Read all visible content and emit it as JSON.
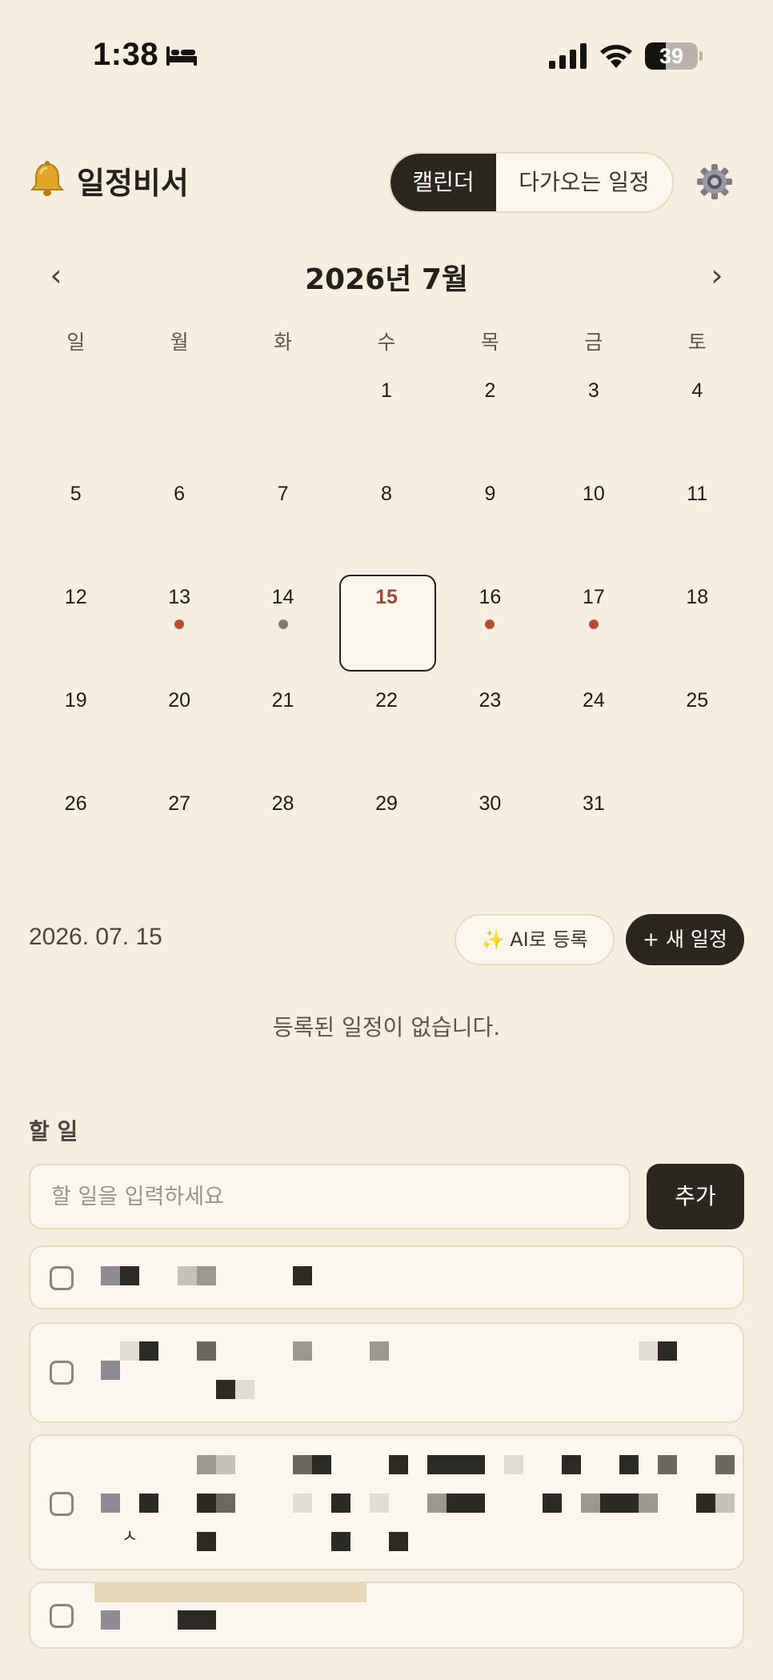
{
  "status_bar": {
    "time": "1:38",
    "battery_percent": 39,
    "battery_label": "39",
    "icons": [
      "bed-icon",
      "cellular-signal-icon",
      "wifi-icon",
      "battery-icon"
    ]
  },
  "header": {
    "logo_icon": "bell-icon",
    "title": "일정비서",
    "view_tabs": [
      {
        "label": "캘린더",
        "active": true
      },
      {
        "label": "다가오는 일정",
        "active": false
      }
    ],
    "settings_icon": "gear-icon"
  },
  "calendar": {
    "month_title": "2026년 7월",
    "prev_label": "‹",
    "next_label": "›",
    "weekdays": [
      "일",
      "월",
      "화",
      "수",
      "목",
      "금",
      "토"
    ],
    "leading_empty_days": 3,
    "days_in_month": 31,
    "selected_day": 15,
    "event_days": [
      {
        "day": 13,
        "color": "#b84c34"
      },
      {
        "day": 14,
        "color": "#827a6c"
      },
      {
        "day": 16,
        "color": "#b84c34"
      },
      {
        "day": 17,
        "color": "#b84c34"
      }
    ]
  },
  "day_panel": {
    "selected_date": "2026. 07. 15",
    "ai_register_icon": "sparkles-icon",
    "ai_register_label": "AI로 등록",
    "new_event_label": "+ 새 일정",
    "empty_message": "등록된 일정이 없습니다."
  },
  "todo": {
    "title": "할 일",
    "input_placeholder": "할 일을 입력하세요",
    "input_value": "",
    "add_label": "추가",
    "items_redacted": true,
    "visible_fragment": "ㅅ"
  },
  "colors": {
    "background": "#f6efe1",
    "surface": "#fbf7ee",
    "border": "#e8dcbf",
    "primary_dark": "#2b271f",
    "accent_red": "#a9452f",
    "event_dot_red": "#b84c34",
    "event_dot_grey": "#827a6c"
  }
}
